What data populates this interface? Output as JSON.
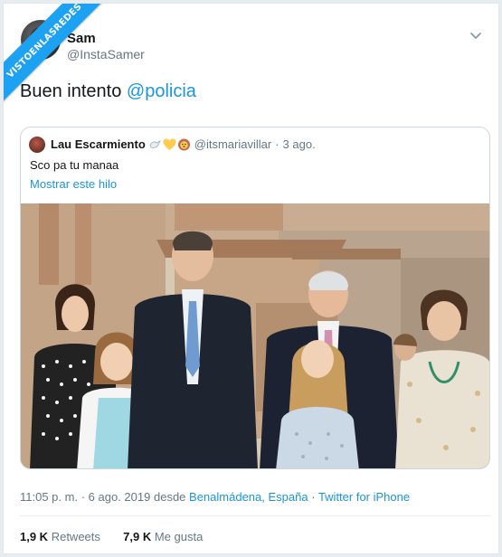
{
  "watermark": {
    "text": "VISTOENLASREDES"
  },
  "author": {
    "name": "Sam",
    "handle": "@InstaSamer"
  },
  "tweet": {
    "text": "Buen intento",
    "mention": "@policia"
  },
  "quoted": {
    "name": "Lau Escarmiento",
    "emojis": [
      "dove-icon",
      "yellow-heart-icon",
      "lion-icon"
    ],
    "handle": "@itsmariavillar",
    "separator": "·",
    "date": "3 ago.",
    "text": "Sco pa tu manaa",
    "show_thread": "Mostrar este hilo"
  },
  "meta": {
    "time": "11:05 p. m.",
    "sep1": "·",
    "date": "6 ago. 2019",
    "from": "desde",
    "location": "Benalmádena, España",
    "sep2": "·",
    "client": "Twitter for iPhone"
  },
  "stats": {
    "retweets_count": "1,9 K",
    "retweets_label": "Retweets",
    "likes_count": "7,9 K",
    "likes_label": "Me gusta"
  },
  "colors": {
    "accent": "#1b95e0",
    "secondary_text": "#657786",
    "ribbon": "#1da1f2"
  }
}
